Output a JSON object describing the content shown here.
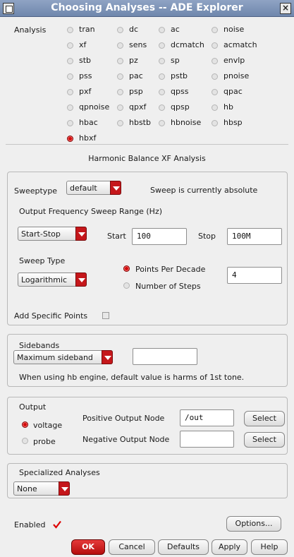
{
  "window": {
    "title": "Choosing Analyses -- ADE Explorer"
  },
  "analysis": {
    "label": "Analysis",
    "selected": "hbxf",
    "options": [
      "tran",
      "dc",
      "ac",
      "noise",
      "xf",
      "sens",
      "dcmatch",
      "acmatch",
      "stb",
      "pz",
      "sp",
      "envlp",
      "pss",
      "pac",
      "pstb",
      "pnoise",
      "pxf",
      "psp",
      "qpss",
      "qpac",
      "qpnoise",
      "qpxf",
      "qpsp",
      "hb",
      "hbac",
      "hbstb",
      "hbnoise",
      "hbsp",
      "hbxf"
    ]
  },
  "section_title": "Harmonic Balance XF Analysis",
  "sweep": {
    "sweeptype_label": "Sweeptype",
    "sweeptype_value": "default",
    "status": "Sweep is currently absolute",
    "range_label": "Output Frequency Sweep Range (Hz)",
    "range_mode": "Start-Stop",
    "start_label": "Start",
    "start_value": "100",
    "stop_label": "Stop",
    "stop_value": "100M",
    "type_label": "Sweep Type",
    "type_value": "Logarithmic",
    "points_per_decade_label": "Points Per Decade",
    "points_per_decade_selected": true,
    "number_of_steps_label": "Number of Steps",
    "points_value": "4",
    "add_points_label": "Add Specific Points",
    "add_points_checked": false
  },
  "sidebands": {
    "label": "Sidebands",
    "mode": "Maximum sideband",
    "value": "",
    "note": "When using hb engine, default value is harms of 1st tone."
  },
  "output": {
    "label": "Output",
    "voltage_label": "voltage",
    "probe_label": "probe",
    "selected": "voltage",
    "pos_label": "Positive Output Node",
    "pos_value": "/out",
    "neg_label": "Negative Output Node",
    "neg_value": "",
    "select_label": "Select"
  },
  "specialized": {
    "label": "Specialized Analyses",
    "value": "None"
  },
  "footer": {
    "enabled_label": "Enabled",
    "enabled_checked": true,
    "options_label": "Options...",
    "ok_label": "OK",
    "cancel_label": "Cancel",
    "defaults_label": "Defaults",
    "apply_label": "Apply",
    "help_label": "Help"
  },
  "colors": {
    "accent": "#c5171b",
    "titlebar": "#7f95ba"
  }
}
